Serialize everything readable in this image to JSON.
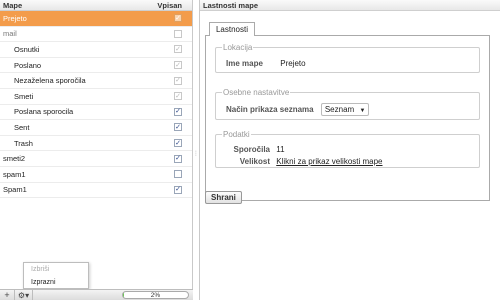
{
  "left": {
    "header": {
      "name_col": "Mape",
      "check_col": "Vpisan"
    },
    "folders": [
      {
        "label": "Prejeto",
        "checked": true,
        "disabled": true,
        "selected": true,
        "sub": false
      },
      {
        "label": "mail",
        "checked": false,
        "disabled": true,
        "selected": false,
        "sub": false,
        "dim": true
      },
      {
        "label": "Osnutki",
        "checked": true,
        "disabled": true,
        "selected": false,
        "sub": true
      },
      {
        "label": "Poslano",
        "checked": true,
        "disabled": true,
        "selected": false,
        "sub": true
      },
      {
        "label": "Nezaželena sporočila",
        "checked": true,
        "disabled": true,
        "selected": false,
        "sub": true
      },
      {
        "label": "Smeti",
        "checked": true,
        "disabled": true,
        "selected": false,
        "sub": true
      },
      {
        "label": "Poslana sporocila",
        "checked": true,
        "disabled": false,
        "selected": false,
        "sub": true
      },
      {
        "label": "Sent",
        "checked": true,
        "disabled": false,
        "selected": false,
        "sub": true
      },
      {
        "label": "Trash",
        "checked": true,
        "disabled": false,
        "selected": false,
        "sub": true
      },
      {
        "label": "smeti2",
        "checked": true,
        "disabled": false,
        "selected": false,
        "sub": false
      },
      {
        "label": "spam1",
        "checked": false,
        "disabled": false,
        "selected": false,
        "sub": false
      },
      {
        "label": "Spam1",
        "checked": true,
        "disabled": false,
        "selected": false,
        "sub": false
      }
    ],
    "context_menu": {
      "delete_label": "Izbriši",
      "empty_label": "Izprazni"
    },
    "footer": {
      "add_label": "+",
      "gear_label": "⚙▾",
      "quota_text": "2%",
      "quota_fraction": 0.02
    }
  },
  "right": {
    "title": "Lastnosti mape",
    "tab_label": "Lastnosti",
    "location": {
      "legend": "Lokacija",
      "name_key": "Ime mape",
      "name_value": "Prejeto"
    },
    "settings": {
      "legend": "Osebne nastavitve",
      "list_mode_key": "Način prikaza seznama",
      "list_mode_value": "Seznam"
    },
    "data": {
      "legend": "Podatki",
      "messages_key": "Sporočila",
      "messages_value": "11",
      "size_key": "Velikost",
      "size_link": "Klikni za prikaz velikosti mape"
    },
    "save_label": "Shrani"
  },
  "icons": {
    "add": "plus-icon",
    "gear": "gear-icon",
    "check": "check-icon",
    "dropdown": "chevron-down-icon"
  },
  "colors": {
    "selected_row": "#f39c4b",
    "quota_fill": "#61c34a"
  }
}
